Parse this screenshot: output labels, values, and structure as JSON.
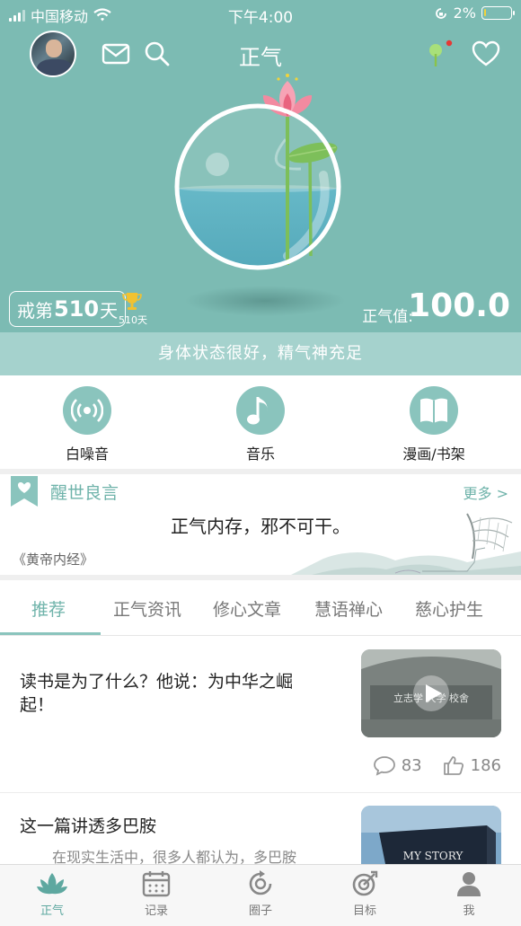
{
  "status_bar": {
    "carrier": "中国移动",
    "time": "下午4:00",
    "battery_percent": "2%",
    "battery_level": 0.05
  },
  "nav": {
    "title": "正气",
    "icons": [
      "mail-icon",
      "search-icon",
      "plant-icon",
      "heart-icon"
    ],
    "notification_dot_color": "#e53935"
  },
  "hero": {
    "streak_prefix": "戒第",
    "streak_days": "510",
    "streak_suffix": "天",
    "trophy_days": "510天",
    "qi_label": "正气值:",
    "qi_value": "100.0"
  },
  "status_message": "身体状态很好，精气神充足",
  "actions": [
    {
      "label": "白噪音",
      "icon": "white-noise-icon"
    },
    {
      "label": "音乐",
      "icon": "music-note-icon"
    },
    {
      "label": "漫画/书架",
      "icon": "book-icon"
    }
  ],
  "quote": {
    "title": "醒世良言",
    "more": "更多 >",
    "text": "正气内存，邪不可干。",
    "source": "《黄帝内经》"
  },
  "tabs": [
    "推荐",
    "正气资讯",
    "修心文章",
    "慧语禅心",
    "慈心护生"
  ],
  "active_tab": 0,
  "articles": [
    {
      "title": "读书是为了什么？他说：为中华之崛起！",
      "comments": "83",
      "likes": "186",
      "thumb_text": "立志学 大学 校舍"
    },
    {
      "title": "这一篇讲透多巴胺",
      "summary": "在现实生活中，很多人都认为，多巴胺",
      "thumb_text": "MY STORY"
    }
  ],
  "tabbar": [
    {
      "label": "正气",
      "icon": "lotus-icon"
    },
    {
      "label": "记录",
      "icon": "calendar-icon"
    },
    {
      "label": "圈子",
      "icon": "circle-refresh-icon"
    },
    {
      "label": "目标",
      "icon": "target-icon"
    },
    {
      "label": "我",
      "icon": "user-icon"
    }
  ],
  "colors": {
    "primary": "#7cbbb3",
    "accent": "#6fb3aa",
    "banner": "#a5d2cd",
    "battery": "#f2d33a"
  }
}
